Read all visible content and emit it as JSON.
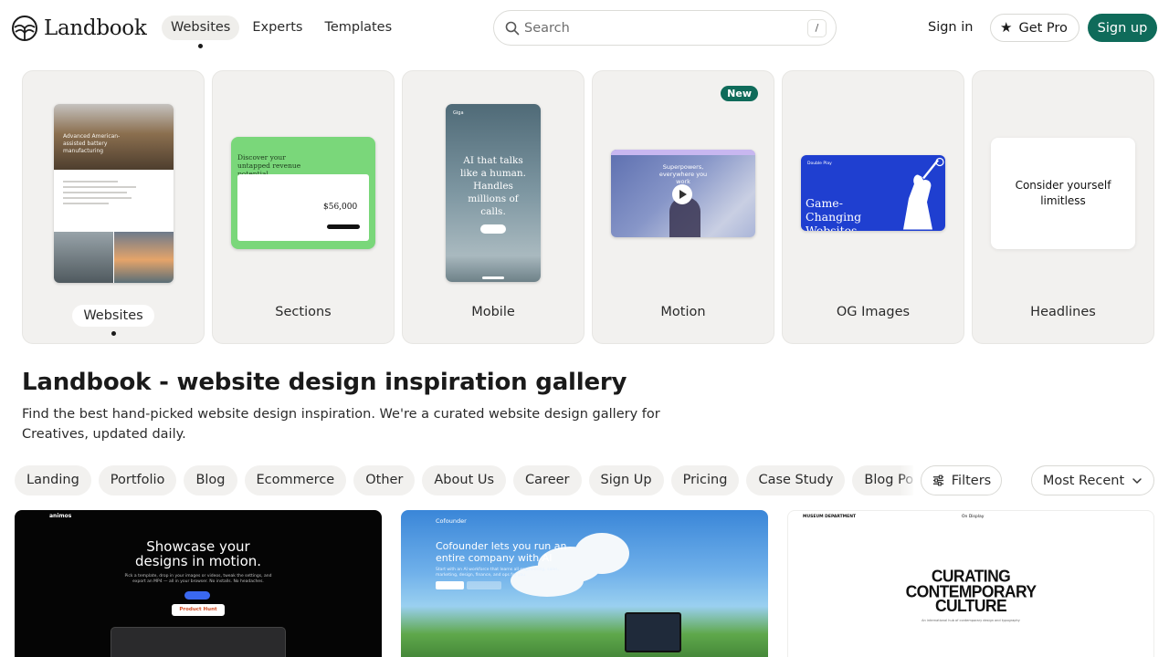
{
  "brand": {
    "name": "Landbook"
  },
  "nav": {
    "items": [
      {
        "label": "Websites",
        "active": true
      },
      {
        "label": "Experts",
        "active": false
      },
      {
        "label": "Templates",
        "active": false
      }
    ]
  },
  "search": {
    "placeholder": "Search",
    "shortcut": "/"
  },
  "auth": {
    "signin": "Sign in",
    "getpro": "Get Pro",
    "signup": "Sign up"
  },
  "categories": [
    {
      "label": "Websites",
      "active": true,
      "badge": ""
    },
    {
      "label": "Sections",
      "active": false,
      "badge": ""
    },
    {
      "label": "Mobile",
      "active": false,
      "badge": ""
    },
    {
      "label": "Motion",
      "active": false,
      "badge": "New"
    },
    {
      "label": "OG Images",
      "active": false,
      "badge": ""
    },
    {
      "label": "Headlines",
      "active": false,
      "badge": ""
    }
  ],
  "previews": {
    "websites": {
      "headline": "Advanced American-assisted battery manufacturing"
    },
    "sections": {
      "headline": "Discover your untapped revenue potential",
      "amount": "$56,000"
    },
    "mobile": {
      "brand": "Giga",
      "headline": "AI that talks like a human. Handles millions of calls."
    },
    "motion": {
      "headline": "Superpowers, everywhere you work"
    },
    "og": {
      "small": "Double Play",
      "headline": "Game-Changing Websites"
    },
    "headlines": {
      "headline": "Consider yourself limitless"
    }
  },
  "page": {
    "title": "Landbook - website design inspiration gallery",
    "subtitle": "Find the best hand-picked website design inspiration. We're a curated website design gallery for Creatives, updated daily."
  },
  "filters": {
    "chips": [
      "Landing",
      "Portfolio",
      "Blog",
      "Ecommerce",
      "Other",
      "About Us",
      "Career",
      "Sign Up",
      "Pricing",
      "Case Study",
      "Blog Post"
    ],
    "filters_label": "Filters",
    "sort_label": "Most Recent"
  },
  "gallery": [
    {
      "brand": "animos",
      "headline": "Showcase your designs in motion.",
      "subtext": "Pick a template, drop in your images or videos, tweak the settings, and export an MP4 — all in your browser. No installs. No headaches.",
      "badge": "Product Hunt"
    },
    {
      "brand": "Cofounder",
      "headline": "Cofounder lets you run an entire company with AI",
      "subtext": "Start with an AI workforce that learns all engineering, sales, marketing, design, finance, and ops for you."
    },
    {
      "brand": "MUSEUM DEPARTMENT",
      "nav": "On Display",
      "headline": "CURATING CONTEMPORARY CULTURE",
      "subtext": "An international hub of contemporary design and typography"
    }
  ],
  "colors": {
    "accent": "#0f6b5a",
    "chip_bg": "#f2f1ef",
    "card_bg": "#f2f1ef"
  }
}
